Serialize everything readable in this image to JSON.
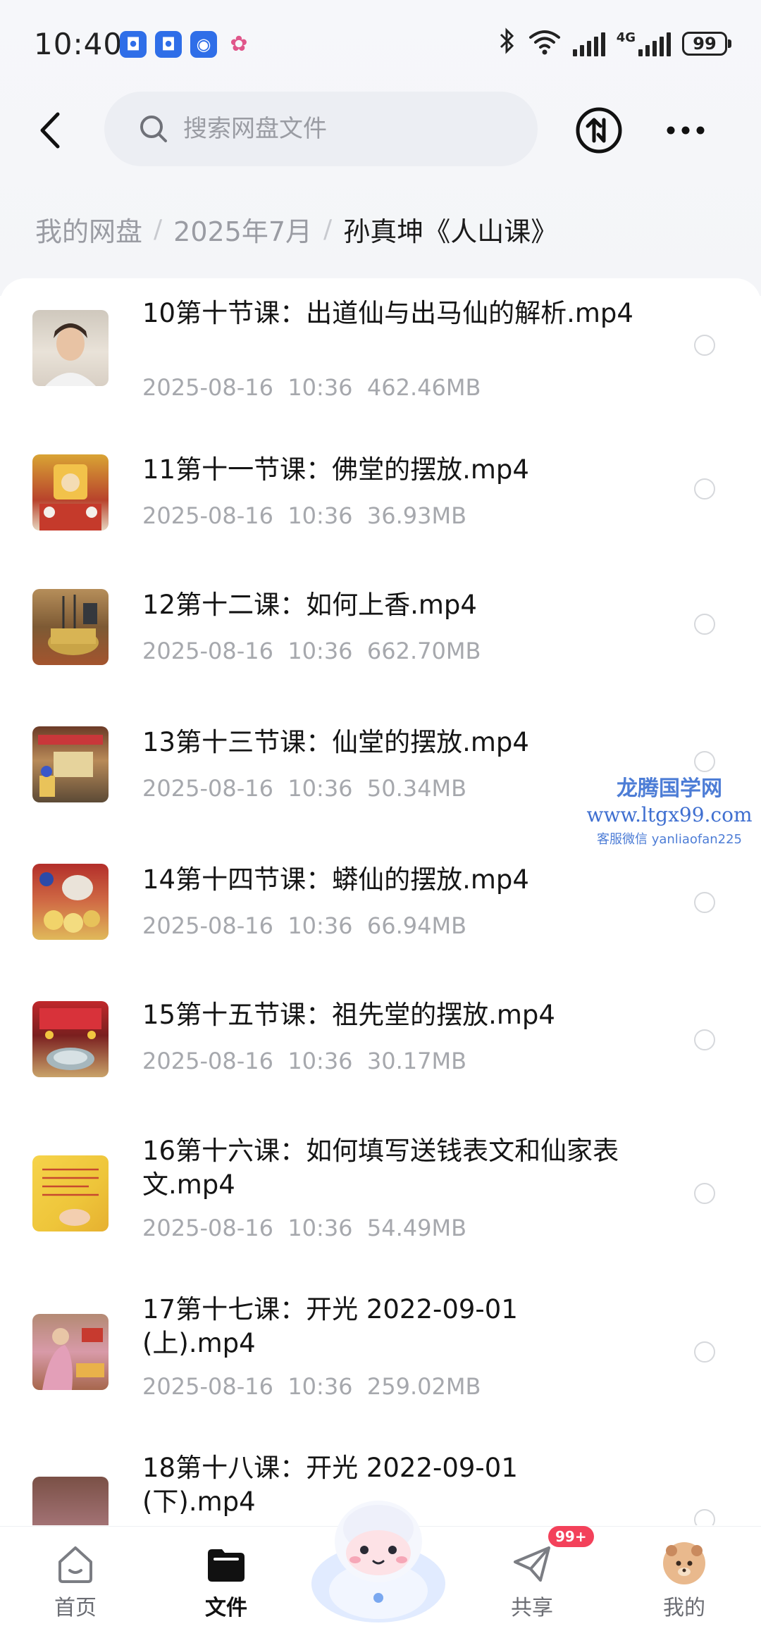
{
  "status_bar": {
    "time": "10:40",
    "app_icons": [
      "shield-app-icon",
      "shield-app-icon",
      "browser-app-icon",
      "clover-app-icon"
    ],
    "network_type": "4G",
    "battery_level": "99"
  },
  "header": {
    "search_placeholder": "搜索网盘文件"
  },
  "breadcrumb": {
    "items": [
      "我的网盘",
      "2025年7月"
    ],
    "current": "孙真坤《人山课》"
  },
  "files": [
    {
      "name": "10第十节课：出道仙与出马仙的解析.mp4",
      "date": "2025-08-16",
      "time": "10:36",
      "size": "462.46MB"
    },
    {
      "name": "11第十一节课：佛堂的摆放.mp4",
      "date": "2025-08-16",
      "time": "10:36",
      "size": "36.93MB"
    },
    {
      "name": "12第十二课：如何上香.mp4",
      "date": "2025-08-16",
      "time": "10:36",
      "size": "662.70MB"
    },
    {
      "name": "13第十三节课：仙堂的摆放.mp4",
      "date": "2025-08-16",
      "time": "10:36",
      "size": "50.34MB"
    },
    {
      "name": "14第十四节课：蟒仙的摆放.mp4",
      "date": "2025-08-16",
      "time": "10:36",
      "size": "66.94MB"
    },
    {
      "name": "15第十五节课：祖先堂的摆放.mp4",
      "date": "2025-08-16",
      "time": "10:36",
      "size": "30.17MB"
    },
    {
      "name": "16第十六课：如何填写送钱表文和仙家表文.mp4",
      "date": "2025-08-16",
      "time": "10:36",
      "size": "54.49MB"
    },
    {
      "name": "17第十七课：开光 2022-09-01 (上).mp4",
      "date": "2025-08-16",
      "time": "10:36",
      "size": "259.02MB"
    },
    {
      "name": "18第十八课：开光 2022-09-01 (下).mp4",
      "date": "",
      "time": "",
      "size": ""
    }
  ],
  "watermark": {
    "title": "龙腾国学网",
    "url": "www.ltgx99.com",
    "contact": "客服微信 yanliaofan225"
  },
  "bottom_nav": {
    "items": [
      {
        "label": "首页",
        "icon": "home-icon"
      },
      {
        "label": "文件",
        "icon": "folder-icon",
        "active": true
      },
      {
        "label": "共享",
        "icon": "send-icon"
      },
      {
        "label": "我的",
        "icon": "avatar-icon"
      }
    ],
    "share_badge": "99+",
    "center_icon": "assistant-mascot-icon"
  },
  "colors": {
    "accent_blue": "#2f6ee8",
    "badge_red": "#f3415a",
    "meta_gray": "#a6a8ad"
  }
}
